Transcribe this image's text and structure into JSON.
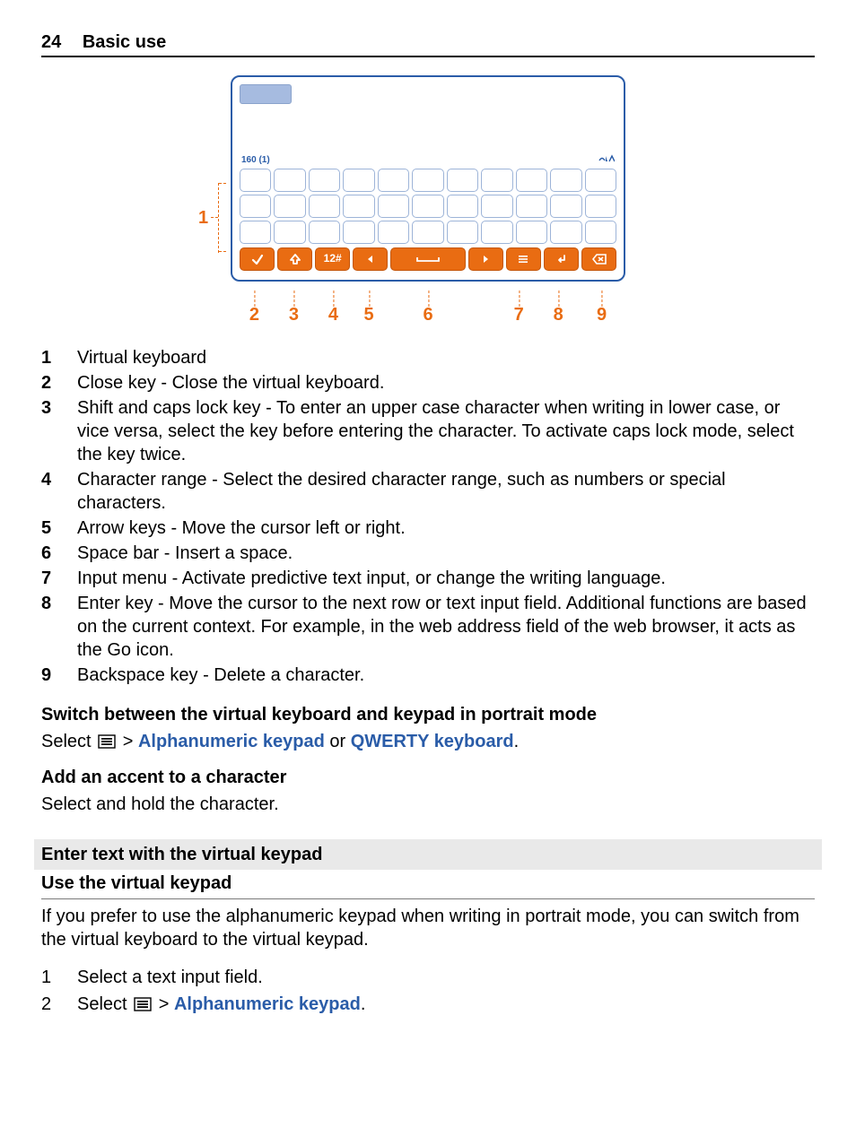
{
  "header": {
    "page_number": "24",
    "section": "Basic use"
  },
  "diagram": {
    "sms_counter": "160 (1)",
    "char_range_label": "12#",
    "callouts": [
      "1",
      "2",
      "3",
      "4",
      "5",
      "6",
      "7",
      "8",
      "9"
    ]
  },
  "legend": [
    {
      "n": "1",
      "text": "Virtual keyboard"
    },
    {
      "n": "2",
      "text": "Close key - Close the virtual keyboard."
    },
    {
      "n": "3",
      "text": "Shift and caps lock key - To enter an upper case character when writing in lower case, or vice versa, select the key before entering the character. To activate caps lock mode, select the key twice."
    },
    {
      "n": "4",
      "text": "Character range - Select the desired character range, such as numbers or special characters."
    },
    {
      "n": "5",
      "text": "Arrow keys - Move the cursor left or right."
    },
    {
      "n": "6",
      "text": "Space bar - Insert a space."
    },
    {
      "n": "7",
      "text": "Input menu - Activate predictive text input, or change the writing language."
    },
    {
      "n": "8",
      "text": "Enter key - Move the cursor to the next row or text input field. Additional functions are based on the current context. For example, in the web address field of the web browser, it acts as the Go icon."
    },
    {
      "n": "9",
      "text": "Backspace key - Delete a character."
    }
  ],
  "switch": {
    "heading": "Switch between the virtual keyboard and keypad in portrait mode",
    "select_word": "Select",
    "gt": " > ",
    "alpha": "Alphanumeric keypad",
    "or": " or ",
    "qwerty": "QWERTY keyboard",
    "period": "."
  },
  "accent": {
    "heading": "Add an accent to a character",
    "body": "Select and hold the character."
  },
  "keypad_section": {
    "band": "Enter text with the virtual keypad",
    "subhead": "Use the virtual keypad",
    "intro": "If you prefer to use the alphanumeric keypad when writing in portrait mode, you can switch from the virtual keyboard to the virtual keypad."
  },
  "steps": [
    {
      "n": "1",
      "text": "Select a text input field."
    },
    {
      "n": "2",
      "select_word": "Select",
      "gt": " > ",
      "alpha": "Alphanumeric keypad",
      "period": "."
    }
  ]
}
